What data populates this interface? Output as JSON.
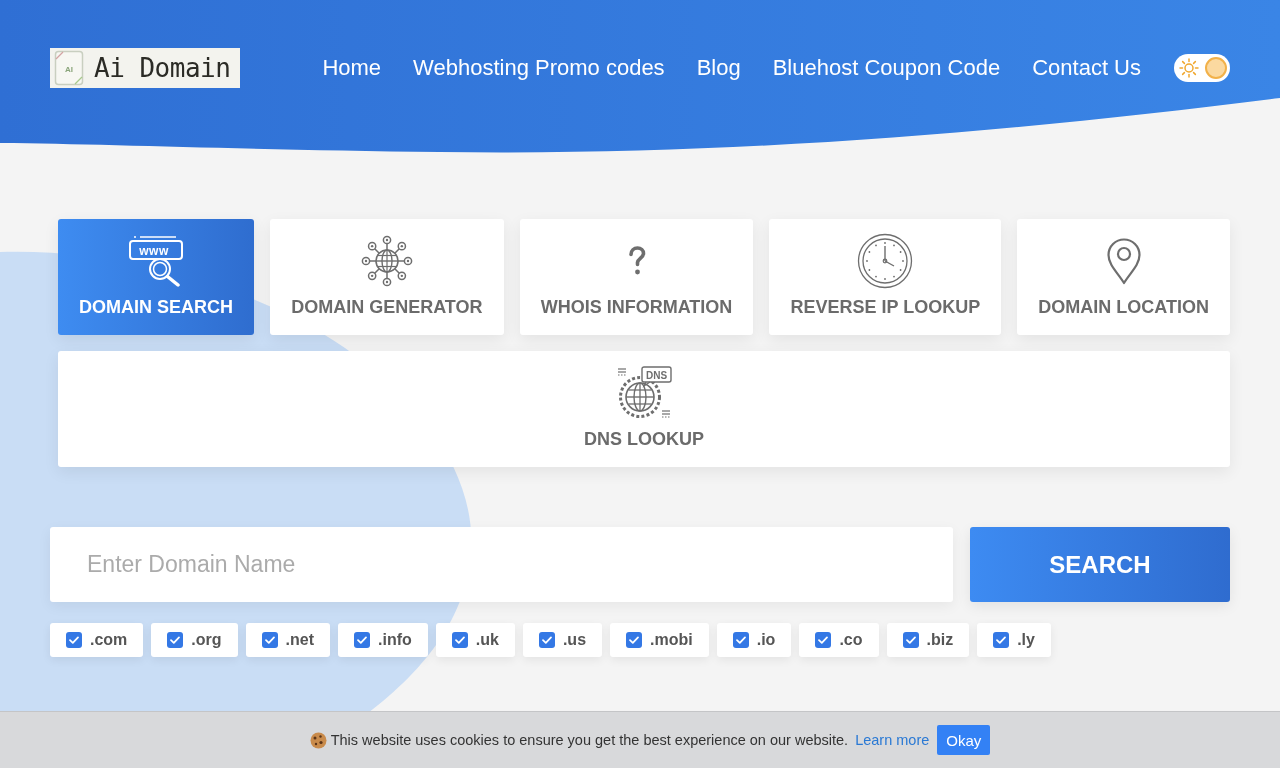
{
  "header": {
    "logo": {
      "mark": "AI",
      "text": "Ai Domain"
    },
    "nav": [
      "Home",
      "Webhosting Promo codes",
      "Blog",
      "Bluehost Coupon Code",
      "Contact Us"
    ],
    "theme_toggle": {
      "on": true
    }
  },
  "tools": [
    {
      "kind": "domain_search",
      "label": "DOMAIN SEARCH",
      "icon_text": "www",
      "selected": true
    },
    {
      "kind": "domain_generator",
      "label": "DOMAIN GENERATOR",
      "selected": false
    },
    {
      "kind": "whois",
      "label": "WHOIS INFORMATION",
      "selected": false
    },
    {
      "kind": "reverse_ip",
      "label": "REVERSE IP LOOKUP",
      "selected": false
    },
    {
      "kind": "location",
      "label": "DOMAIN LOCATION",
      "selected": false
    },
    {
      "kind": "dns",
      "label": "DNS LOOKUP",
      "icon_text": "DNS",
      "selected": false
    }
  ],
  "search": {
    "placeholder": "Enter Domain Name",
    "button": "SEARCH"
  },
  "extensions": [
    {
      "label": ".com",
      "checked": true
    },
    {
      "label": ".org",
      "checked": true
    },
    {
      "label": ".net",
      "checked": true
    },
    {
      "label": ".info",
      "checked": true
    },
    {
      "label": ".uk",
      "checked": true
    },
    {
      "label": ".us",
      "checked": true
    },
    {
      "label": ".mobi",
      "checked": true
    },
    {
      "label": ".io",
      "checked": true
    },
    {
      "label": ".co",
      "checked": true
    },
    {
      "label": ".biz",
      "checked": true
    },
    {
      "label": ".ly",
      "checked": true
    }
  ],
  "cookie_bar": {
    "message": "This website uses cookies to ensure you get the best experience on our website.",
    "link": "Learn more",
    "button": "Okay"
  }
}
